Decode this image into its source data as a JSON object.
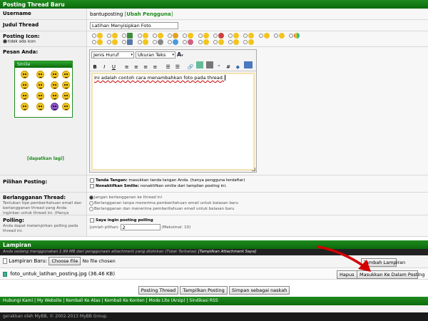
{
  "header": {
    "title": "Posting Thread Baru"
  },
  "username": {
    "label": "Username",
    "value": "bantuposting",
    "change_link": "Ubah Pengguna"
  },
  "thread_title": {
    "label": "Judul Thread",
    "value": "Latihan Menyisipkan Foto"
  },
  "post_icon": {
    "label": "Posting Icon:",
    "no_icon": "tidak ada icon"
  },
  "message": {
    "label": "Pesan Anda:",
    "smilies_title": "Smilie",
    "more_smilies": "[dapatkan lagi]",
    "font_select": "Jenis Huruf",
    "size_select": "Ukuran Teks",
    "body_text": "Ini adalah contoh cara menambahkan foto pada thread."
  },
  "toolbar": {
    "bold": "B",
    "italic": "I",
    "underline": "U",
    "font_color": "A"
  },
  "options": {
    "label": "Pilihan Posting:",
    "signature_label": "Tanda Tangan:",
    "signature_text": "masukkan tanda tangan Anda. (hanya pengguna terdaftar)",
    "disable_smilies_label": "Nonaktifkan Smilie:",
    "disable_smilies_text": "nonaktifkan smilie dari tampilan posting ini."
  },
  "subscribe": {
    "label": "Berlangganan Thread:",
    "description": "Tentukan tipe pemberitahuan email dan berlangganan thread yang Anda inginkan untuk thread ini. (Hanya pengguna terdaftar)",
    "opt1": "Jangan berlangganan ke thread ini",
    "opt2": "Berlangganan tanpa menerima pemberitahuan email untuk balasan baru",
    "opt3": "Berlangganan dan menerima pemberitahuan email untuk balasan baru"
  },
  "poll": {
    "label": "Polling:",
    "description": "Anda dapat melampirkan polling pada thread ini.",
    "checkbox_label": "Saya ingin posting polling",
    "options_label": "Jumlah pilihan:",
    "options_value": "2",
    "max_label": "(Maksimal: 10)"
  },
  "attachments": {
    "title": "Lampiran",
    "usage_text": "Anda sedang menggunakan 1.99 MB dari penggunaan attachment yang diizinkan (Tidak Terbatas)",
    "view_link": "[Tampilkan Attachment Saya]",
    "new_label": "Lampiran Baru:",
    "choose_button": "Choose File",
    "no_file": "No file chosen",
    "add_button": "Tambah Lampiran",
    "file_name": "foto_untuk_latihan_posting.jpg (36.46 KB)",
    "delete_button": "Hapus",
    "insert_button": "Masukkan Ke Dalam Posting"
  },
  "actions": {
    "post": "Posting Thread",
    "preview": "Tampilkan Posting",
    "save_draft": "Simpan sebagai naskah"
  },
  "footer": {
    "links": [
      "Hubungi Kami",
      "My Website",
      "Kembali Ke Atas",
      "Kembali Ke Konten",
      "Mode Lite (Arsip)",
      "Sindikasi RSS"
    ],
    "powered": "gerakkan oleh MyBB, © 2002-2013 MyBB Group."
  },
  "colors": {
    "accent_green": "#1e8b1e",
    "annotation_red": "#d40000"
  }
}
